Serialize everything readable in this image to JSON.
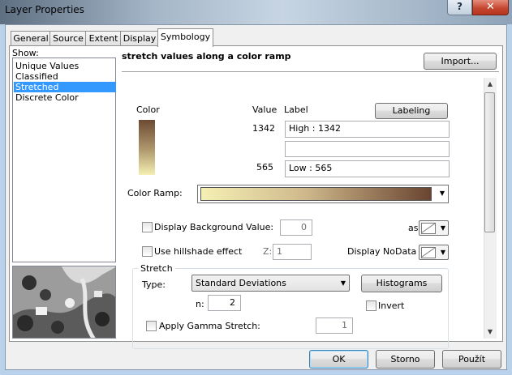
{
  "window": {
    "title": "Layer Properties",
    "help_label": "?",
    "close_label": "✕"
  },
  "tabs": [
    {
      "label": "General"
    },
    {
      "label": "Source"
    },
    {
      "label": "Extent"
    },
    {
      "label": "Display"
    },
    {
      "label": "Symbology"
    }
  ],
  "show": {
    "label": "Show:",
    "items": [
      {
        "label": "Unique Values"
      },
      {
        "label": "Classified"
      },
      {
        "label": "Stretched",
        "selected": true
      },
      {
        "label": "Discrete Color"
      }
    ]
  },
  "symbology": {
    "heading": "stretch values along a color ramp",
    "import_label": "Import...",
    "headers": {
      "color": "Color",
      "value": "Value",
      "label": "Label"
    },
    "labeling_label": "Labeling",
    "high_value": "1342",
    "high_label": "High : 1342",
    "low_value": "565",
    "low_label": "Low : 565",
    "color_ramp_label": "Color Ramp:",
    "ramp_colors": [
      "#f5f0b4",
      "#cfb98c",
      "#6a4430"
    ],
    "display_background_label": "Display Background Value:",
    "background_value": "0",
    "as_label": "as",
    "hillshade_label": "Use hillshade effect",
    "z_label": "Z:",
    "z_value": "1",
    "nodata_label": "Display NoData as"
  },
  "stretch": {
    "group_label": "Stretch",
    "type_label": "Type:",
    "type_value": "Standard Deviations",
    "histograms_label": "Histograms",
    "n_label": "n:",
    "n_value": "2",
    "invert_label": "Invert",
    "gamma_label": "Apply Gamma Stretch:",
    "gamma_value": "1"
  },
  "footer": {
    "ok_label": "OK",
    "cancel_label": "Storno",
    "apply_label": "Použít"
  }
}
